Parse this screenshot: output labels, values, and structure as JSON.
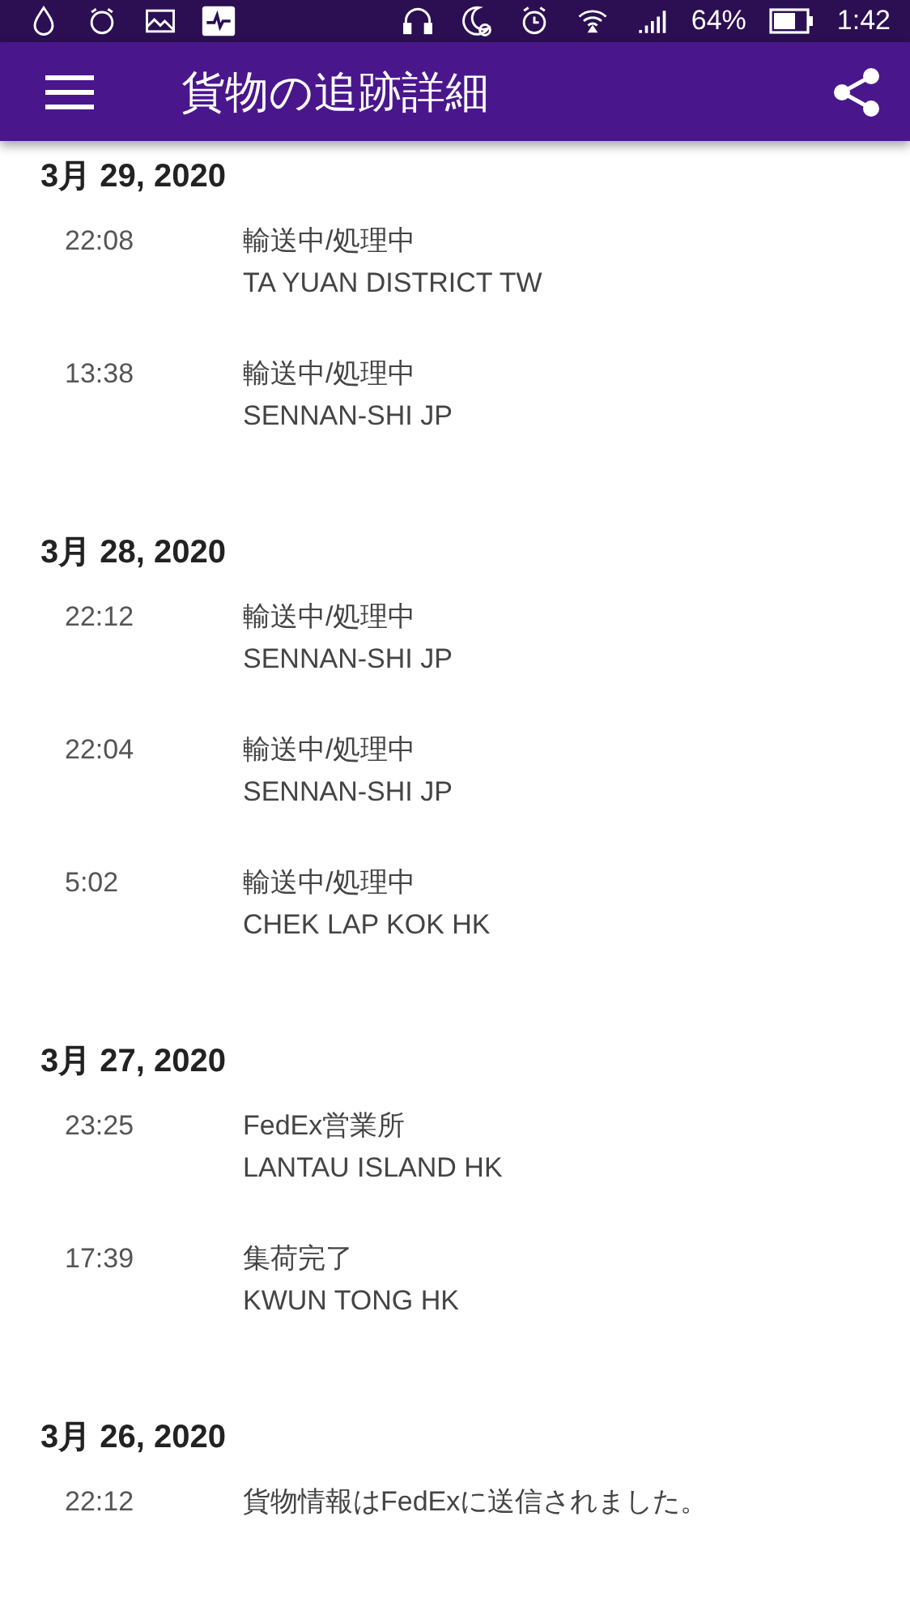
{
  "status_bar": {
    "battery": "64%",
    "time": "1:42"
  },
  "app_bar": {
    "title": "貨物の追跡詳細"
  },
  "days": [
    {
      "date": "3月 29, 2020",
      "events": [
        {
          "time": "22:08",
          "status": "輸送中/処理中",
          "location": "TA YUAN DISTRICT TW"
        },
        {
          "time": "13:38",
          "status": "輸送中/処理中",
          "location": "SENNAN-SHI JP"
        }
      ]
    },
    {
      "date": "3月 28, 2020",
      "events": [
        {
          "time": "22:12",
          "status": "輸送中/処理中",
          "location": "SENNAN-SHI JP"
        },
        {
          "time": "22:04",
          "status": "輸送中/処理中",
          "location": "SENNAN-SHI JP"
        },
        {
          "time": "5:02",
          "status": "輸送中/処理中",
          "location": "CHEK LAP KOK HK"
        }
      ]
    },
    {
      "date": "3月 27, 2020",
      "events": [
        {
          "time": "23:25",
          "status": "FedEx営業所",
          "location": "LANTAU ISLAND HK"
        },
        {
          "time": "17:39",
          "status": "集荷完了",
          "location": "KWUN TONG HK"
        }
      ]
    },
    {
      "date": "3月 26, 2020",
      "events": [
        {
          "time": "22:12",
          "status": "貨物情報はFedExに送信されました。"
        }
      ]
    }
  ]
}
